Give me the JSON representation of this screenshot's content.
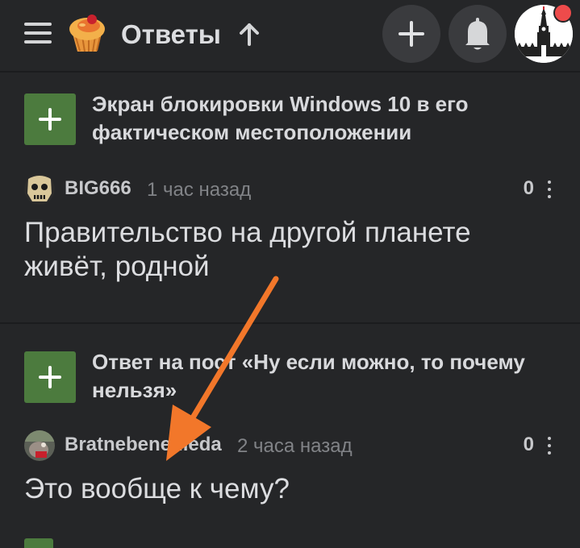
{
  "header": {
    "title": "Ответы",
    "menu_icon": "hamburger-menu-icon",
    "logo_icon": "cupcake-logo-icon",
    "sort_icon": "arrow-up-icon",
    "add_icon": "plus-icon",
    "bell_icon": "bell-icon",
    "avatar_icon": "kremlin-tower-avatar",
    "has_notification": true
  },
  "comments": [
    {
      "post_title": "Экран блокировки Windows 10 в его фактическом местоположении",
      "author": "BIG666",
      "time": "1 час назад",
      "rating": "0",
      "text": "Правительство на другой планете живёт, родной"
    },
    {
      "post_title": "Ответ на пост «Ну если можно, то почему нельзя»",
      "author": "Bratnebenehleda",
      "time": "2 часа назад",
      "rating": "0",
      "text": "Это вообще к чему?"
    }
  ],
  "colors": {
    "background": "#252628",
    "accent_green": "#4c7b3e",
    "notification": "#ee4b4b",
    "annotation_arrow": "#f2772a"
  }
}
